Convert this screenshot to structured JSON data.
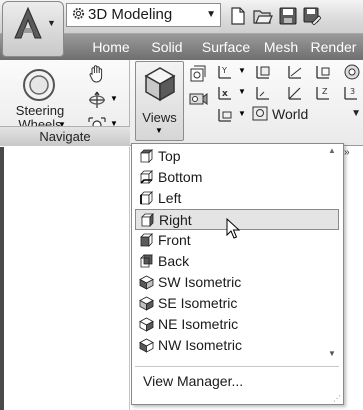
{
  "window": {
    "workspace_value": "3D Modeling"
  },
  "ribbon": {
    "tabs": [
      {
        "label": "Home"
      },
      {
        "label": "Solid"
      },
      {
        "label": "Surface"
      },
      {
        "label": "Mesh"
      },
      {
        "label": "Render"
      }
    ],
    "navigate_panel": {
      "title": "Navigate",
      "steering_wheels_label_line1": "Steering",
      "steering_wheels_label_line2": "Wheels"
    },
    "views_label": "Views",
    "ucs_select_value": "World"
  },
  "views_dropdown": {
    "items": [
      {
        "label": "Top",
        "icon": "top-view-icon"
      },
      {
        "label": "Bottom",
        "icon": "bottom-view-icon"
      },
      {
        "label": "Left",
        "icon": "left-view-icon"
      },
      {
        "label": "Right",
        "icon": "right-view-icon",
        "selected": true
      },
      {
        "label": "Front",
        "icon": "front-view-icon"
      },
      {
        "label": "Back",
        "icon": "back-view-icon"
      },
      {
        "label": "SW Isometric",
        "icon": "sw-isometric-icon"
      },
      {
        "label": "SE Isometric",
        "icon": "se-isometric-icon"
      },
      {
        "label": "NE Isometric",
        "icon": "ne-isometric-icon"
      },
      {
        "label": "NW Isometric",
        "icon": "nw-isometric-icon"
      }
    ],
    "view_manager_label": "View Manager..."
  },
  "colors": {
    "tab_bar": "#7a7a7a",
    "selected_item_bg": "#e4e4e4",
    "menu_border": "#8a8a8a"
  }
}
